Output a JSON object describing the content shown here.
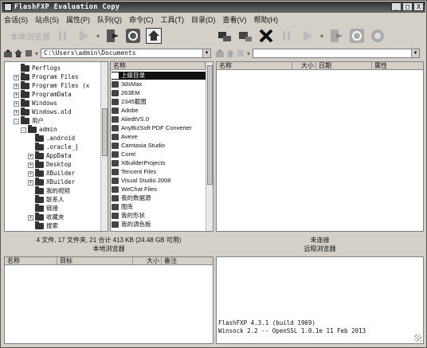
{
  "window": {
    "title": "FlashFXP Evaluation Copy",
    "buttons": [
      "_",
      "□",
      "X"
    ]
  },
  "menu": [
    "会话(S)",
    "站点(S)",
    "属性(P)",
    "队列(Q)",
    "命令(C)",
    "工具(T)",
    "目录(D)",
    "查看(V)",
    "帮助(H)"
  ],
  "toolbar": {
    "local_label": "本地浏览器"
  },
  "local": {
    "path": "C:\\Users\\admin\\Documents",
    "tree": [
      {
        "label": "Perflogs",
        "indent": 1,
        "expand": ""
      },
      {
        "label": "Program Files",
        "indent": 1,
        "expand": "+"
      },
      {
        "label": "Program Files (x",
        "indent": 1,
        "expand": "+"
      },
      {
        "label": "ProgramData",
        "indent": 1,
        "expand": "+"
      },
      {
        "label": "Windows",
        "indent": 1,
        "expand": "+"
      },
      {
        "label": "Windows.old",
        "indent": 1,
        "expand": "+"
      },
      {
        "label": "用户",
        "indent": 1,
        "expand": "-"
      },
      {
        "label": "admin",
        "indent": 2,
        "expand": "-"
      },
      {
        "label": ".android",
        "indent": 3,
        "expand": ""
      },
      {
        "label": ".oracle_j",
        "indent": 3,
        "expand": ""
      },
      {
        "label": "AppData",
        "indent": 3,
        "expand": "+"
      },
      {
        "label": "Desktop",
        "indent": 3,
        "expand": "+"
      },
      {
        "label": "XBuilder",
        "indent": 3,
        "expand": "+"
      },
      {
        "label": "XBuilder",
        "indent": 3,
        "expand": "+"
      },
      {
        "label": "我的视频",
        "indent": 3,
        "expand": ""
      },
      {
        "label": "联系人",
        "indent": 3,
        "expand": ""
      },
      {
        "label": "链接",
        "indent": 3,
        "expand": ""
      },
      {
        "label": "收藏夹",
        "indent": 3,
        "expand": "+"
      },
      {
        "label": "搜索",
        "indent": 3,
        "expand": ""
      }
    ],
    "columns": [
      "名称"
    ],
    "files": [
      "上级目录",
      "3dsMax",
      "263EM",
      "2345截图",
      "Adobe",
      "AliedtVS.0",
      "AnyBizSoft PDF Converter",
      "Avexe",
      "Camtasia Studio",
      "Corel",
      "XBuilderProjects",
      "Tencent Files",
      "Visual Studio 2008",
      "WeChat Files",
      "我的数据源",
      "图库",
      "我的形状",
      "我的调色板"
    ],
    "status": "4 文件, 17 文件夹, 21 合计 413 KB (24.48 GB 可用)",
    "label": "本地浏览器"
  },
  "remote": {
    "columns": [
      "名称",
      "大小",
      "日期",
      "属性"
    ],
    "status": "未连接",
    "label": "远程浏览器"
  },
  "queue": {
    "columns": [
      "名称",
      "目标",
      "大小",
      "备注"
    ]
  },
  "log": {
    "lines": [
      "FlashFXP 4.3.1 (build 1969)",
      "Winsock 2.2 -- OpenSSL 1.0.1e 11 Feb 2013"
    ]
  }
}
